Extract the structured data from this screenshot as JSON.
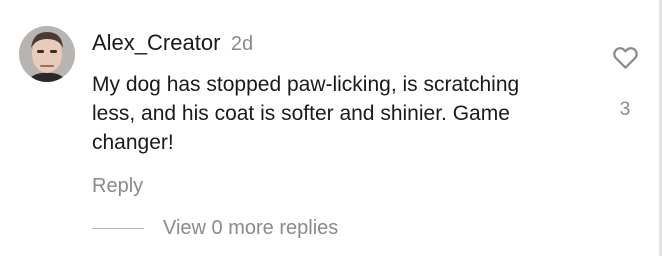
{
  "comment": {
    "username": "Alex_Creator",
    "time_ago": "2d",
    "text": "My dog has stopped paw-licking, is scratching less, and his coat is softer and shinier. Game changer!",
    "reply_label": "Reply",
    "view_more_label": "View 0 more replies",
    "like_count": "3",
    "like_icon": "heart-outline-icon"
  }
}
